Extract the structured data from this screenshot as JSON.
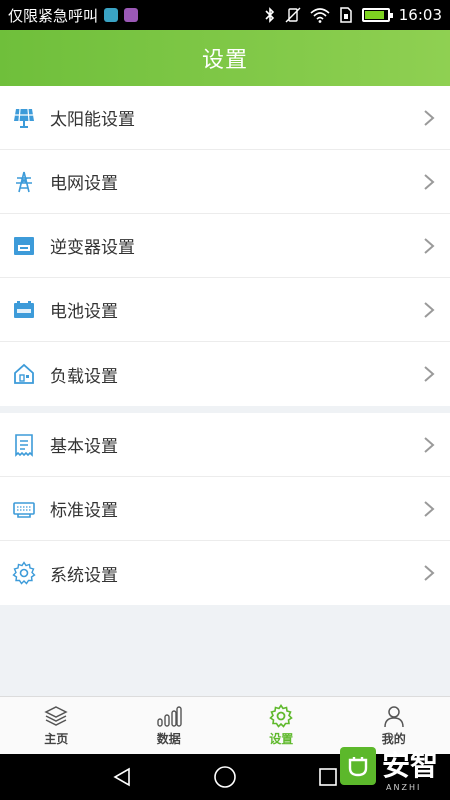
{
  "status_bar": {
    "carrier_text": "仅限紧急呼叫",
    "time": "16:03",
    "battery_level": 0.9
  },
  "header": {
    "title": "设置"
  },
  "settings_groups": [
    {
      "items": [
        {
          "label": "太阳能设置",
          "icon": "solar-panel-icon"
        },
        {
          "label": "电网设置",
          "icon": "power-tower-icon"
        },
        {
          "label": "逆变器设置",
          "icon": "inverter-icon"
        },
        {
          "label": "电池设置",
          "icon": "battery-icon"
        },
        {
          "label": "负载设置",
          "icon": "house-load-icon"
        }
      ]
    },
    {
      "items": [
        {
          "label": "基本设置",
          "icon": "document-icon"
        },
        {
          "label": "标准设置",
          "icon": "standard-icon"
        },
        {
          "label": "系统设置",
          "icon": "gear-icon"
        }
      ]
    }
  ],
  "bottom_nav": [
    {
      "label": "主页",
      "icon": "layers-icon",
      "active": false
    },
    {
      "label": "数据",
      "icon": "bar-chart-icon",
      "active": false
    },
    {
      "label": "设置",
      "icon": "gear-icon",
      "active": true
    },
    {
      "label": "我的",
      "icon": "person-icon",
      "active": false
    }
  ],
  "watermark": {
    "text": "安智",
    "subtext": "ANZHI"
  },
  "colors": {
    "accent_green": "#6fbf3b",
    "active_tab": "#5fb92c",
    "icon_blue": "#3d9bd9"
  }
}
